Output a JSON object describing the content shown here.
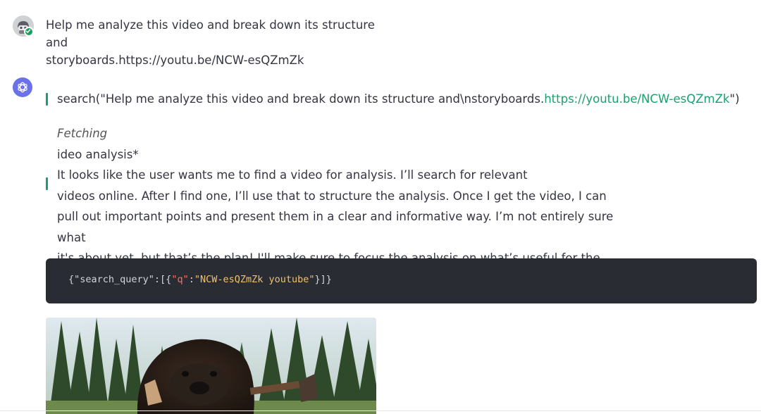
{
  "user_message": {
    "line1": "Help me analyze this video and break down its structure and",
    "line2": "storyboards.https://youtu.be/NCW-esQZmZk"
  },
  "assistant": {
    "search_call": {
      "prefix": "search(\"Help me analyze this video and break down its structure and\\nstoryboards.",
      "link": "https://youtu.be/NCW-esQZmZk",
      "suffix": "\")"
    },
    "thought": {
      "status": "Fetching",
      "lines": [
        "ideo analysis*",
        "It looks like the user wants me to find a video for analysis. I’ll search for relevant",
        "videos online. After I find one, I’ll use that to structure the analysis. Once I get the video, I can",
        "pull out important points and present them in a clear and informative way. I’m not entirely sure what",
        "it's about yet, but that’s the plan! I'll make sure to focus the analysis on what’s useful for the user"
      ]
    },
    "code": {
      "open": "{\"search_query\":[{",
      "key": "\"q\"",
      "colon": ":",
      "value": "\"NCW-esQZmZk youtube\"",
      "close": "}]}"
    }
  },
  "colors": {
    "accent_green": "#1aa06d",
    "bot_avatar": "#6b72e8",
    "code_bg": "#2a2c34"
  },
  "icons": {
    "user_avatar": "robot-avatar-icon",
    "verified": "check-badge-icon",
    "bot_avatar": "openai-logo-icon"
  }
}
